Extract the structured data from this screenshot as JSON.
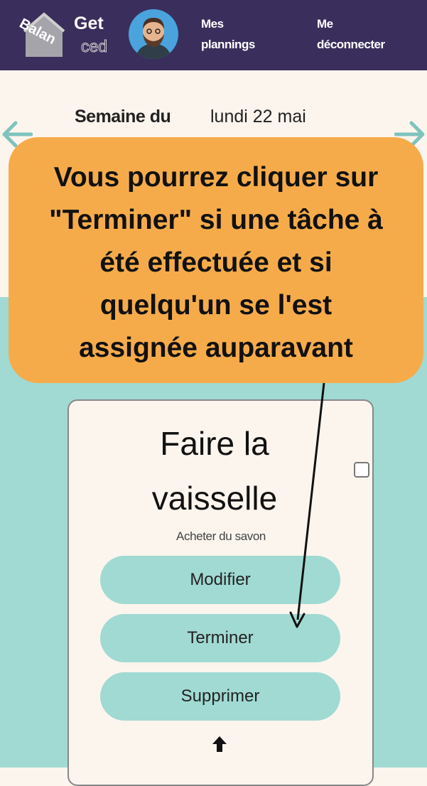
{
  "header": {
    "logo": {
      "word_top": "Get",
      "word_bottom": "ced",
      "word_arc": "Balan",
      "icon": "house-icon"
    },
    "avatar_icon": "user-avatar-icon",
    "nav": {
      "plannings": [
        "Mes",
        "plannings"
      ],
      "logout": [
        "Me",
        "déconnecter"
      ]
    }
  },
  "week": {
    "label": "Semaine du",
    "value": "lundi 22 mai"
  },
  "callout": {
    "lines": [
      "Vous pourrez cliquer sur",
      "\"Terminer\" si une tâche à",
      "été effectuée et si",
      "quelqu'un se l'est",
      "assignée auparavant"
    ]
  },
  "task": {
    "title": [
      "Faire la",
      "vaisselle"
    ],
    "description": "Acheter du savon",
    "done": false,
    "buttons": {
      "edit": "Modifier",
      "finish": "Terminer",
      "delete": "Supprimer"
    }
  },
  "colors": {
    "header": "#3a2e5c",
    "page": "#fcf5ee",
    "teal": "#a0dad3",
    "callout": "#f6ab4a",
    "arrow": "#7fc3bd"
  }
}
